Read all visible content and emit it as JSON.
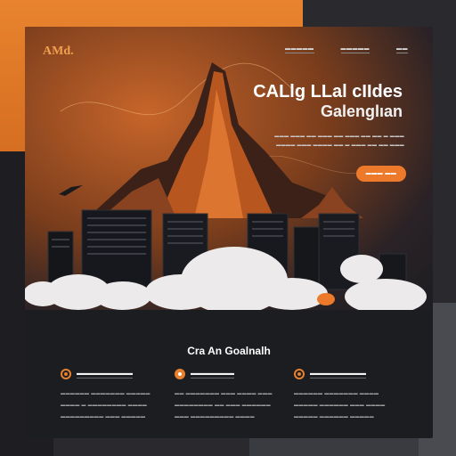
{
  "brand": {
    "logo": "AMd."
  },
  "nav": {
    "items": [
      "▬▬▬▬▬",
      "▬▬▬▬▬",
      "▬▬"
    ]
  },
  "hero": {
    "title_line1": "CALlg LLal cIIdes",
    "title_line2": "Galenglıan",
    "text": "▬▬▬ ▬▬▬ ▬▬ ▬▬▬ ▬▬ ▬▬▬ ▬▬ ▬▬ ▬ ▬▬▬ ▬▬▬▬ ▬▬▬ ▬▬▬▬ ▬▬ ▬ ▬▬▬ ▬▬ ▬▬ ▬▬▬",
    "cta_label": "▬▬▬ ▬▬"
  },
  "section": {
    "title": "Cra An Goalnalh"
  },
  "features": [
    {
      "title": "▬▬▬▬▬▬▬▬▬",
      "desc": "▬▬▬▬▬▬ ▬▬▬▬▬▬▬ ▬▬▬▬▬ ▬▬▬▬ ▬ ▬▬▬▬▬▬▬▬ ▬▬▬▬ ▬▬▬▬▬▬▬▬▬ ▬▬▬ ▬▬▬▬▬",
      "icon": "target-icon",
      "filled": false
    },
    {
      "title": "▬▬▬▬▬▬▬",
      "desc": "▬▬ ▬▬▬▬▬▬▬ ▬▬▬ ▬▬▬▬ ▬▬▬ ▬▬▬▬▬▬▬▬ ▬▬ ▬▬▬ ▬▬▬▬▬▬ ▬▬▬ ▬▬▬▬▬▬▬▬▬ ▬▬▬▬",
      "icon": "settings-icon",
      "filled": true
    },
    {
      "title": "▬▬▬▬▬▬▬▬▬",
      "desc": "▬▬▬▬▬▬ ▬▬▬▬▬▬▬ ▬▬▬▬ ▬▬▬▬▬ ▬▬▬▬▬▬ ▬▬▬ ▬▬▬▬ ▬▬▬▬▬ ▬▬▬▬▬▬ ▬▬▬▬▬",
      "icon": "target-icon",
      "filled": false
    }
  ],
  "colors": {
    "accent": "#ec7a2a",
    "card": "#1c1d21",
    "orange_panel": "#e8832e"
  }
}
